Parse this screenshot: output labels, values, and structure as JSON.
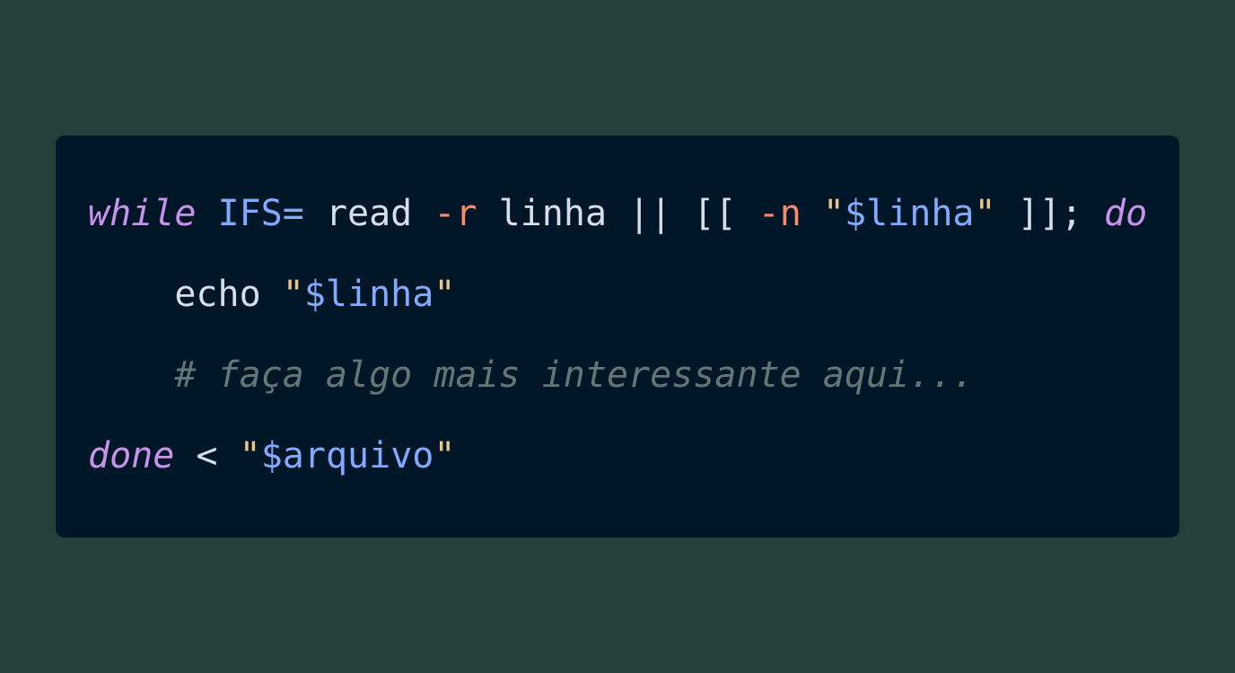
{
  "code": {
    "line1": {
      "kw_while": "while",
      "ifs": "IFS=",
      "read": "read",
      "flag_r": "-r",
      "var_linha": "linha",
      "ops": "|| [[",
      "flag_n": "-n",
      "quote_open": "\"",
      "dollar_linha": "$linha",
      "quote_close": "\"",
      "close": "]];",
      "kw_do": "do"
    },
    "line2": {
      "indent": "    ",
      "echo": "echo",
      "quote_open": "\"",
      "dollar_linha": "$linha",
      "quote_close": "\""
    },
    "line3": {
      "indent": "    ",
      "comment": "# faça algo mais interessante aqui..."
    },
    "line4": {
      "kw_done": "done",
      "redirect": "<",
      "quote_open": "\"",
      "dollar_arquivo": "$arquivo",
      "quote_close": "\""
    }
  },
  "colors": {
    "background": "#253f3a",
    "editor_background": "#011627",
    "keyword": "#c792ea",
    "variable": "#82aaff",
    "text": "#d6deeb",
    "flag": "#f78c6c",
    "string_quote": "#ecc48d",
    "comment": "#637777"
  }
}
